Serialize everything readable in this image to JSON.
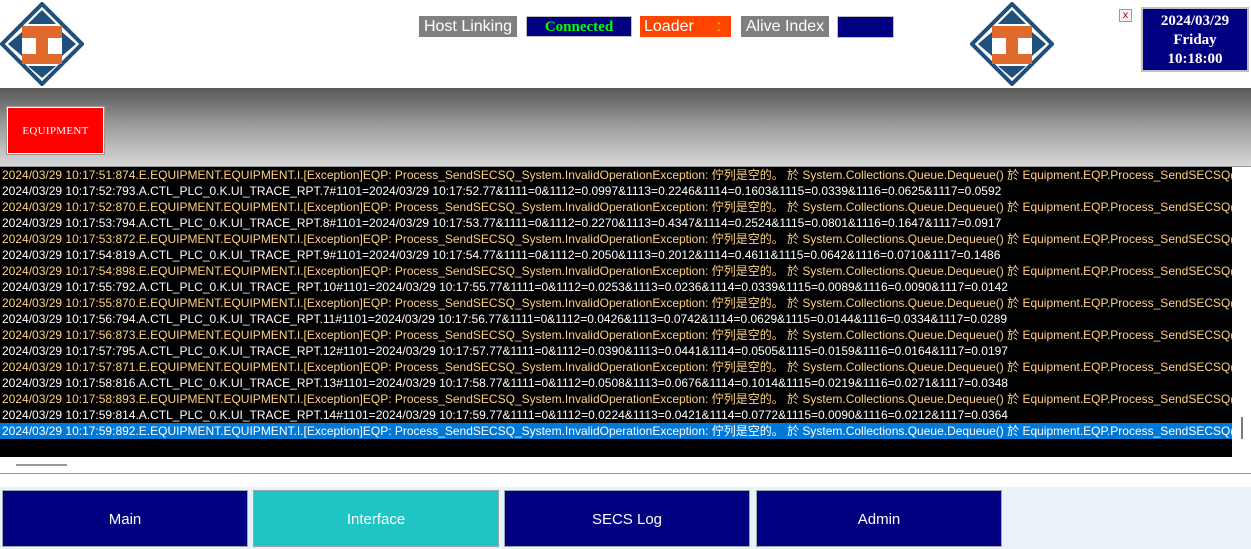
{
  "header": {
    "host_label": "Host Linking",
    "host_status": "Connected",
    "loader_label": "Loader",
    "loader_colon": ":",
    "alive_label": "Alive Index",
    "alive_value": "",
    "close_label": "x",
    "date": "2024/03/29",
    "weekday": "Friday",
    "time": "10:18:00"
  },
  "equipment_button": "EQUIPMENT",
  "log_lines": [
    {
      "type": "exc",
      "text": "2024/03/29 10:17:51:874.E.EQUIPMENT.EQUIPMENT.I.[Exception]EQP: Process_SendSECSQ_System.InvalidOperationException: 佇列是空的。    於 System.Collections.Queue.Dequeue()    於 Equipment.EQP.Process_SendSECSQ()"
    },
    {
      "type": "trace",
      "text": "2024/03/29 10:17:52:793.A.CTL_PLC_0.K.UI_TRACE_RPT.7#1101=2024/03/29 10:17:52.77&1111=0&1112=0.0997&1113=0.2246&1114=0.1603&1115=0.0339&1116=0.0625&1117=0.0592"
    },
    {
      "type": "exc",
      "text": "2024/03/29 10:17:52:870.E.EQUIPMENT.EQUIPMENT.I.[Exception]EQP: Process_SendSECSQ_System.InvalidOperationException: 佇列是空的。    於 System.Collections.Queue.Dequeue()    於 Equipment.EQP.Process_SendSECSQ()"
    },
    {
      "type": "trace",
      "text": "2024/03/29 10:17:53:794.A.CTL_PLC_0.K.UI_TRACE_RPT.8#1101=2024/03/29 10:17:53.77&1111=0&1112=0.2270&1113=0.4347&1114=0.2524&1115=0.0801&1116=0.1647&1117=0.0917"
    },
    {
      "type": "exc",
      "text": "2024/03/29 10:17:53:872.E.EQUIPMENT.EQUIPMENT.I.[Exception]EQP: Process_SendSECSQ_System.InvalidOperationException: 佇列是空的。    於 System.Collections.Queue.Dequeue()    於 Equipment.EQP.Process_SendSECSQ()"
    },
    {
      "type": "trace",
      "text": "2024/03/29 10:17:54:819.A.CTL_PLC_0.K.UI_TRACE_RPT.9#1101=2024/03/29 10:17:54.77&1111=0&1112=0.2050&1113=0.2012&1114=0.4611&1115=0.0642&1116=0.0710&1117=0.1486"
    },
    {
      "type": "exc",
      "text": "2024/03/29 10:17:54:898.E.EQUIPMENT.EQUIPMENT.I.[Exception]EQP: Process_SendSECSQ_System.InvalidOperationException: 佇列是空的。    於 System.Collections.Queue.Dequeue()    於 Equipment.EQP.Process_SendSECSQ()"
    },
    {
      "type": "trace",
      "text": "2024/03/29 10:17:55:792.A.CTL_PLC_0.K.UI_TRACE_RPT.10#1101=2024/03/29 10:17:55.77&1111=0&1112=0.0253&1113=0.0236&1114=0.0339&1115=0.0089&1116=0.0090&1117=0.0142"
    },
    {
      "type": "exc",
      "text": "2024/03/29 10:17:55:870.E.EQUIPMENT.EQUIPMENT.I.[Exception]EQP: Process_SendSECSQ_System.InvalidOperationException: 佇列是空的。    於 System.Collections.Queue.Dequeue()    於 Equipment.EQP.Process_SendSECSQ()"
    },
    {
      "type": "trace",
      "text": "2024/03/29 10:17:56:794.A.CTL_PLC_0.K.UI_TRACE_RPT.11#1101=2024/03/29 10:17:56.77&1111=0&1112=0.0426&1113=0.0742&1114=0.0629&1115=0.0144&1116=0.0334&1117=0.0289"
    },
    {
      "type": "exc",
      "text": "2024/03/29 10:17:56:873.E.EQUIPMENT.EQUIPMENT.I.[Exception]EQP: Process_SendSECSQ_System.InvalidOperationException: 佇列是空的。    於 System.Collections.Queue.Dequeue()    於 Equipment.EQP.Process_SendSECSQ()"
    },
    {
      "type": "trace",
      "text": "2024/03/29 10:17:57:795.A.CTL_PLC_0.K.UI_TRACE_RPT.12#1101=2024/03/29 10:17:57.77&1111=0&1112=0.0390&1113=0.0441&1114=0.0505&1115=0.0159&1116=0.0164&1117=0.0197"
    },
    {
      "type": "exc",
      "text": "2024/03/29 10:17:57:871.E.EQUIPMENT.EQUIPMENT.I.[Exception]EQP: Process_SendSECSQ_System.InvalidOperationException: 佇列是空的。    於 System.Collections.Queue.Dequeue()    於 Equipment.EQP.Process_SendSECSQ()"
    },
    {
      "type": "trace",
      "text": "2024/03/29 10:17:58:816.A.CTL_PLC_0.K.UI_TRACE_RPT.13#1101=2024/03/29 10:17:58.77&1111=0&1112=0.0508&1113=0.0676&1114=0.1014&1115=0.0219&1116=0.0271&1117=0.0348"
    },
    {
      "type": "exc",
      "text": "2024/03/29 10:17:58:893.E.EQUIPMENT.EQUIPMENT.I.[Exception]EQP: Process_SendSECSQ_System.InvalidOperationException: 佇列是空的。    於 System.Collections.Queue.Dequeue()    於 Equipment.EQP.Process_SendSECSQ()"
    },
    {
      "type": "trace",
      "text": "2024/03/29 10:17:59:814.A.CTL_PLC_0.K.UI_TRACE_RPT.14#1101=2024/03/29 10:17:59.77&1111=0&1112=0.0224&1113=0.0421&1114=0.0772&1115=0.0090&1116=0.0212&1117=0.0364"
    },
    {
      "type": "selected",
      "text": "2024/03/29 10:17:59:892.E.EQUIPMENT.EQUIPMENT.I.[Exception]EQP: Process_SendSECSQ_System.InvalidOperationException: 佇列是空的。    於 System.Collections.Queue.Dequeue()    於 Equipment.EQP.Process_SendSECSQ()"
    }
  ],
  "nav": [
    {
      "label": "Main",
      "active": false
    },
    {
      "label": "Interface",
      "active": true
    },
    {
      "label": "SECS Log",
      "active": false
    },
    {
      "label": "Admin",
      "active": false
    }
  ],
  "colors": {
    "navy": "#000080",
    "active_tab": "#1fc4c4",
    "connected_text": "#00ff00",
    "loader_bg": "#ff4500",
    "equipment_red": "#ff0000",
    "log_exception_text": "#ffd27f",
    "log_selected_bg": "#0078d7",
    "logo_orange": "#e06a2c",
    "logo_blue": "#1f4f7a"
  }
}
